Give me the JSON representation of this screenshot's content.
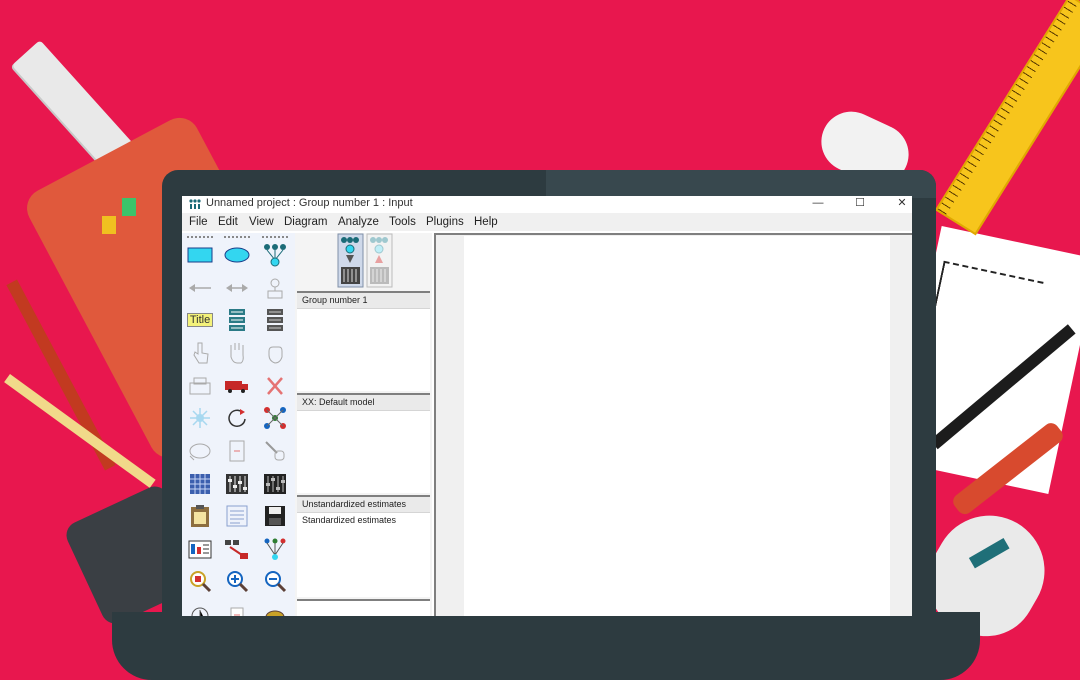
{
  "window": {
    "title": "Unnamed project : Group number 1 : Input",
    "minimize": "—",
    "maximize": "☐",
    "close": "✕"
  },
  "menu": [
    "File",
    "Edit",
    "View",
    "Diagram",
    "Analyze",
    "Tools",
    "Plugins",
    "Help"
  ],
  "toolbox": {
    "title_tool_label": "Title"
  },
  "panels": {
    "groups": {
      "selected": "Group number 1"
    },
    "models": {
      "selected": "XX: Default model"
    },
    "estimates": {
      "items": [
        "Unstandardized estimates",
        "Standardized estimates"
      ]
    }
  },
  "colors": {
    "background": "#e8174e",
    "laptop": "#2d3b40",
    "toolbox": "#eff3fb",
    "accent_cyan": "#33d6f0"
  }
}
